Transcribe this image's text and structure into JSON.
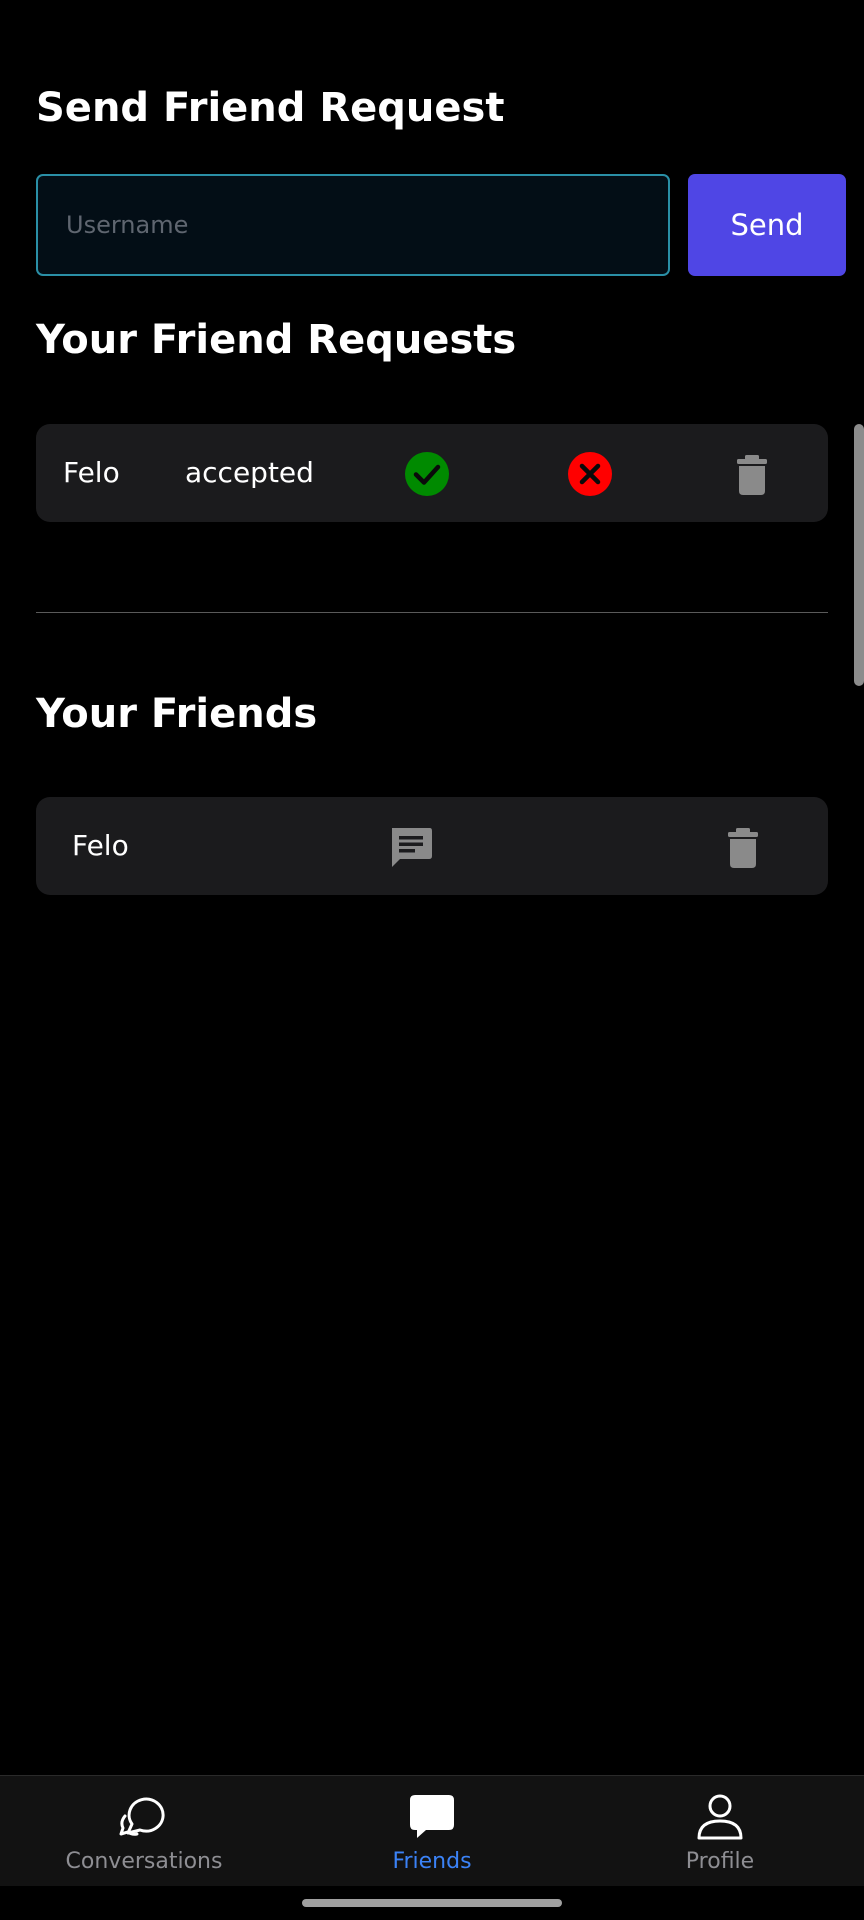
{
  "send_request": {
    "title": "Send Friend Request",
    "input_placeholder": "Username",
    "input_value": "",
    "send_label": "Send"
  },
  "friend_requests": {
    "title": "Your Friend Requests",
    "items": [
      {
        "name": "Felo",
        "status": "accepted",
        "accept_icon": "check-circle-icon",
        "reject_icon": "x-circle-icon",
        "delete_icon": "trash-icon"
      }
    ]
  },
  "friends": {
    "title": "Your Friends",
    "items": [
      {
        "name": "Felo",
        "message_icon": "message-icon",
        "delete_icon": "trash-icon"
      }
    ]
  },
  "tab_bar": {
    "tabs": [
      {
        "label": "Conversations",
        "icon": "chat-bubbles-icon",
        "active": false
      },
      {
        "label": "Friends",
        "icon": "chat-bubble-icon",
        "active": true
      },
      {
        "label": "Profile",
        "icon": "person-icon",
        "active": false
      }
    ]
  },
  "colors": {
    "background": "#000000",
    "card": "#1b1b1d",
    "accent": "#4f46e5",
    "active_tab": "#3b82f6",
    "inactive_tab": "#8e8e93",
    "accept": "#008a00",
    "reject": "#ff0000",
    "icon_gray": "#8a8a8a",
    "input_border": "#2a8fa6"
  }
}
